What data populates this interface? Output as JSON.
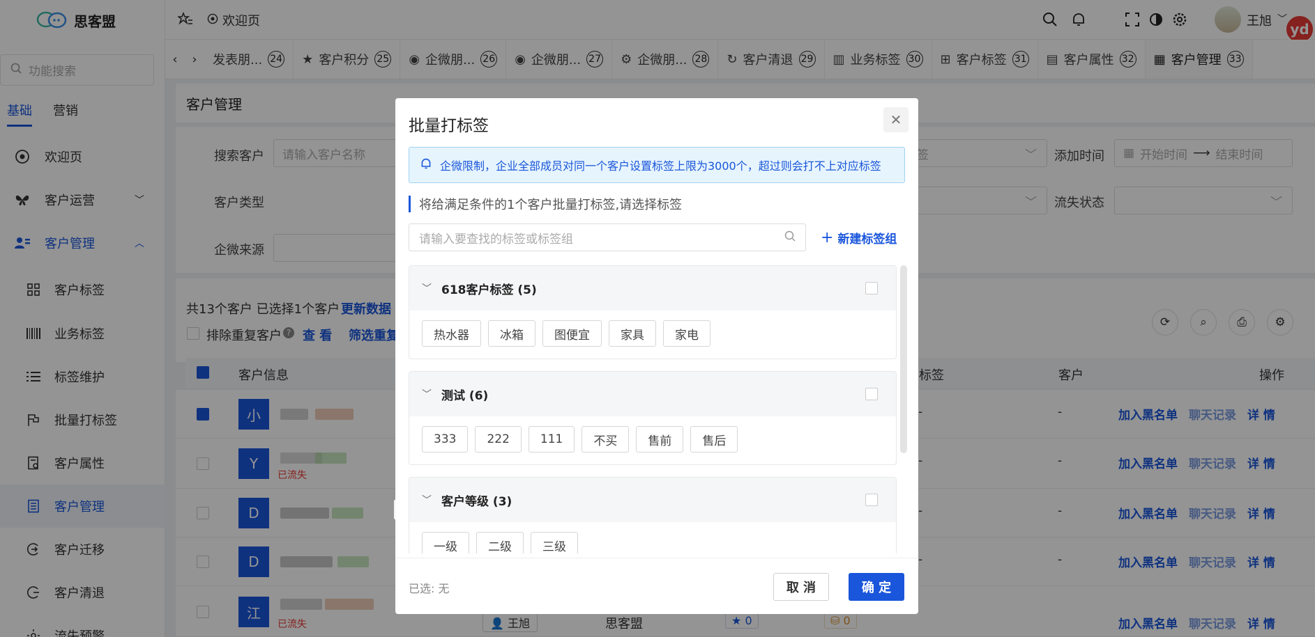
{
  "app": {
    "name": "思客盟"
  },
  "sidebar": {
    "search_placeholder": "功能搜索",
    "mode_tabs": [
      "基础",
      "营销"
    ],
    "items": [
      {
        "label": "欢迎页",
        "icon": "eye-icon"
      },
      {
        "label": "客户运营",
        "icon": "butterfly-icon"
      },
      {
        "label": "客户管理",
        "icon": "users-icon"
      },
      {
        "label": "客户标签",
        "icon": "grid-icon"
      },
      {
        "label": "业务标签",
        "icon": "barcode-icon"
      },
      {
        "label": "标签维护",
        "icon": "list-icon"
      },
      {
        "label": "批量打标签",
        "icon": "flag-icon"
      },
      {
        "label": "客户属性",
        "icon": "document-icon"
      },
      {
        "label": "客户管理",
        "icon": "sheet-icon"
      },
      {
        "label": "客户迁移",
        "icon": "migrate-icon"
      },
      {
        "label": "客户清退",
        "icon": "exit-icon"
      },
      {
        "label": "流失预警",
        "icon": "warning-icon"
      }
    ]
  },
  "topbar": {
    "breadcrumb": "欢迎页",
    "user": "王旭"
  },
  "tabs": [
    {
      "label": "发表朋...",
      "num": "24"
    },
    {
      "label": "客户积分",
      "num": "25"
    },
    {
      "label": "企微朋...",
      "num": "26"
    },
    {
      "label": "企微朋...",
      "num": "27"
    },
    {
      "label": "企微朋...",
      "num": "28"
    },
    {
      "label": "客户清退",
      "num": "29"
    },
    {
      "label": "业务标签",
      "num": "30"
    },
    {
      "label": "客户标签",
      "num": "31"
    },
    {
      "label": "客户属性",
      "num": "32"
    },
    {
      "label": "客户管理",
      "num": "33"
    }
  ],
  "page": {
    "title": "客户管理",
    "filters": {
      "search_label": "搜索客户",
      "search_placeholder": "请输入客户名称",
      "type_label": "客户类型",
      "source_label": "企微来源",
      "tag_fragment": "签",
      "add_time_label": "添加时间",
      "start_placeholder": "开始时间",
      "end_placeholder": "结束时间",
      "lost_label": "流失状态"
    },
    "summary": "共13个客户 已选择1个客户",
    "update_link": "更新数据",
    "dedupe_label": "排除重复客户",
    "view_link": "查 看",
    "filter_link": "筛选重复",
    "columns": {
      "info": "客户信息",
      "tag": "标签",
      "customer_frag": "客户",
      "ops": "操作"
    },
    "rows": [
      {
        "initial": "小",
        "status": "",
        "checked": true
      },
      {
        "initial": "Y",
        "status": "已流失",
        "checked": false
      },
      {
        "initial": "D",
        "status": "",
        "checked": false
      },
      {
        "initial": "D",
        "status": "",
        "checked": false
      },
      {
        "initial": "江",
        "status": "已流失",
        "checked": false,
        "owner": "王旭",
        "company": "思客盟",
        "stars": "0",
        "coins": "0"
      }
    ],
    "dash": "-",
    "row_ops": {
      "blacklist": "加入黑名单",
      "chat": "聊天记录",
      "detail": "详 情"
    }
  },
  "dialog": {
    "title": "批量打标签",
    "alert": "企微限制，企业全部成员对同一个客户设置标签上限为3000个，超过则会打不上对应标签",
    "hint": "将给满足条件的1个客户批量打标签,请选择标签",
    "search_placeholder": "请输入要查找的标签或标签组",
    "new_group": "新建标签组",
    "groups": [
      {
        "name": "618客户标签 (5)",
        "tags": [
          "热水器",
          "冰箱",
          "图便宜",
          "家具",
          "家电"
        ]
      },
      {
        "name": "测试 (6)",
        "tags": [
          "333",
          "222",
          "111",
          "不买",
          "售前",
          "售后"
        ]
      },
      {
        "name": "客户等级 (3)",
        "tags": [
          "一级",
          "二级",
          "三级"
        ]
      }
    ],
    "selected": "已选: 无",
    "cancel": "取 消",
    "confirm": "确 定"
  },
  "colors": {
    "accent": "#1a56db",
    "alert_bg": "#e6f4fd",
    "lost": "#e53935"
  }
}
